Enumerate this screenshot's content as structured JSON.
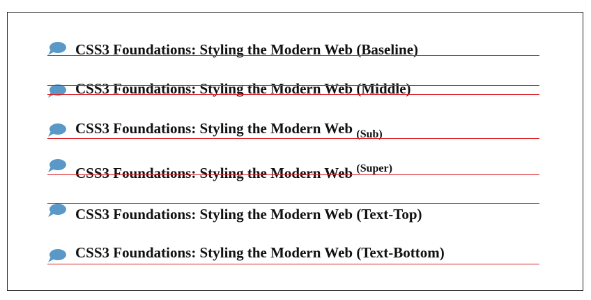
{
  "base_text": "CSS3 Foundations: Styling the Modern Web",
  "rows": [
    {
      "suffix": "(Baseline)"
    },
    {
      "suffix": "(Middle)"
    },
    {
      "suffix": "(Sub)"
    },
    {
      "suffix": "(Super)"
    },
    {
      "suffix": "(Text-Top)"
    },
    {
      "suffix": "(Text-Bottom)"
    }
  ],
  "colors": {
    "rule": "#d9242a",
    "bubble": "#5a98c7",
    "text": "#111111",
    "border": "#222222"
  },
  "icon": "speech-bubble-icon"
}
